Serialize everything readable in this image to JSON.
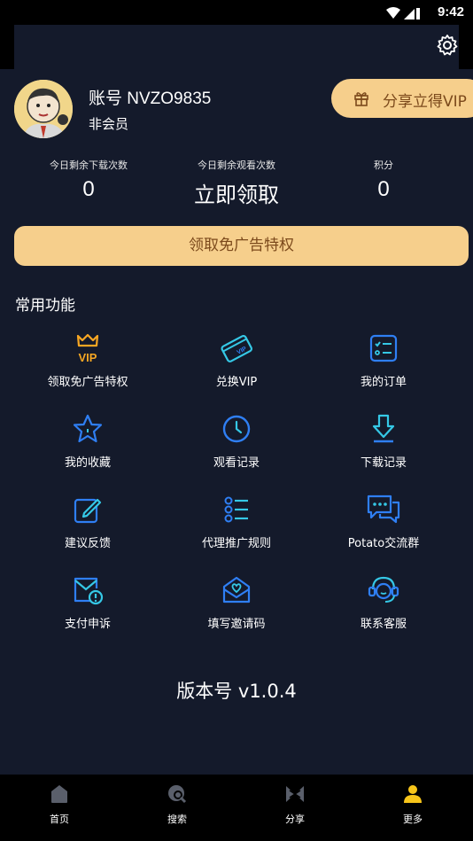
{
  "status_bar": {
    "time": "9:42"
  },
  "profile": {
    "account_label": "账号 NVZO9835",
    "membership": "非会员",
    "share_vip_label": "分享立得VIP"
  },
  "stats": [
    {
      "caption": "今日剩余下载次数",
      "value": "0"
    },
    {
      "caption": "今日剩余观看次数",
      "value": "立即领取"
    },
    {
      "caption": "积分",
      "value": "0"
    }
  ],
  "claim_button_label": "领取免广告特权",
  "section_title": "常用功能",
  "functions": [
    {
      "label": "领取免广告特权",
      "icon": "vip-crown-icon"
    },
    {
      "label": "兑换VIP",
      "icon": "vip-card-icon"
    },
    {
      "label": "我的订单",
      "icon": "order-list-icon"
    },
    {
      "label": "我的收藏",
      "icon": "star-icon"
    },
    {
      "label": "观看记录",
      "icon": "clock-icon"
    },
    {
      "label": "下载记录",
      "icon": "download-icon"
    },
    {
      "label": "建议反馈",
      "icon": "edit-icon"
    },
    {
      "label": "代理推广规则",
      "icon": "list-icon"
    },
    {
      "label": "Potato交流群",
      "icon": "chat-icon"
    },
    {
      "label": "支付申诉",
      "icon": "mail-alert-icon"
    },
    {
      "label": "填写邀请码",
      "icon": "heart-mail-icon"
    },
    {
      "label": "联系客服",
      "icon": "headset-icon"
    }
  ],
  "version_label": "版本号 v1.0.4",
  "tabs": [
    {
      "label": "首页",
      "icon": "home-icon"
    },
    {
      "label": "搜索",
      "icon": "search-icon"
    },
    {
      "label": "分享",
      "icon": "share-icon"
    },
    {
      "label": "更多",
      "icon": "user-icon"
    }
  ],
  "colors": {
    "background": "#141a2b",
    "gold": "#f6cf8c",
    "gold_text": "#7c4a1c",
    "icon_blue": "#2f7ff4",
    "icon_cyan": "#35c8e6",
    "active_tab": "#f7c51a"
  }
}
